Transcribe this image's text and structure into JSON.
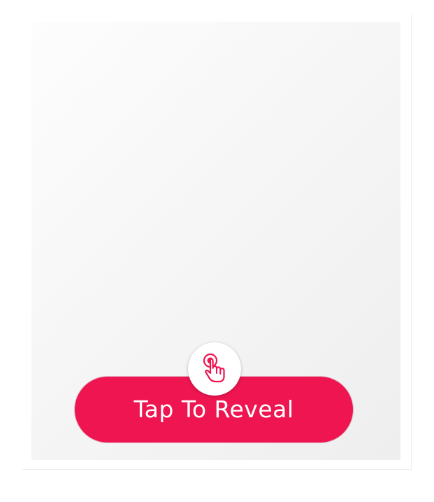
{
  "reveal": {
    "button_label": "Tap To Reveal",
    "icon": "tap-hand-icon"
  },
  "colors": {
    "accent": "#ee1550",
    "panel": "#f4f4f4",
    "background": "#ffffff"
  }
}
